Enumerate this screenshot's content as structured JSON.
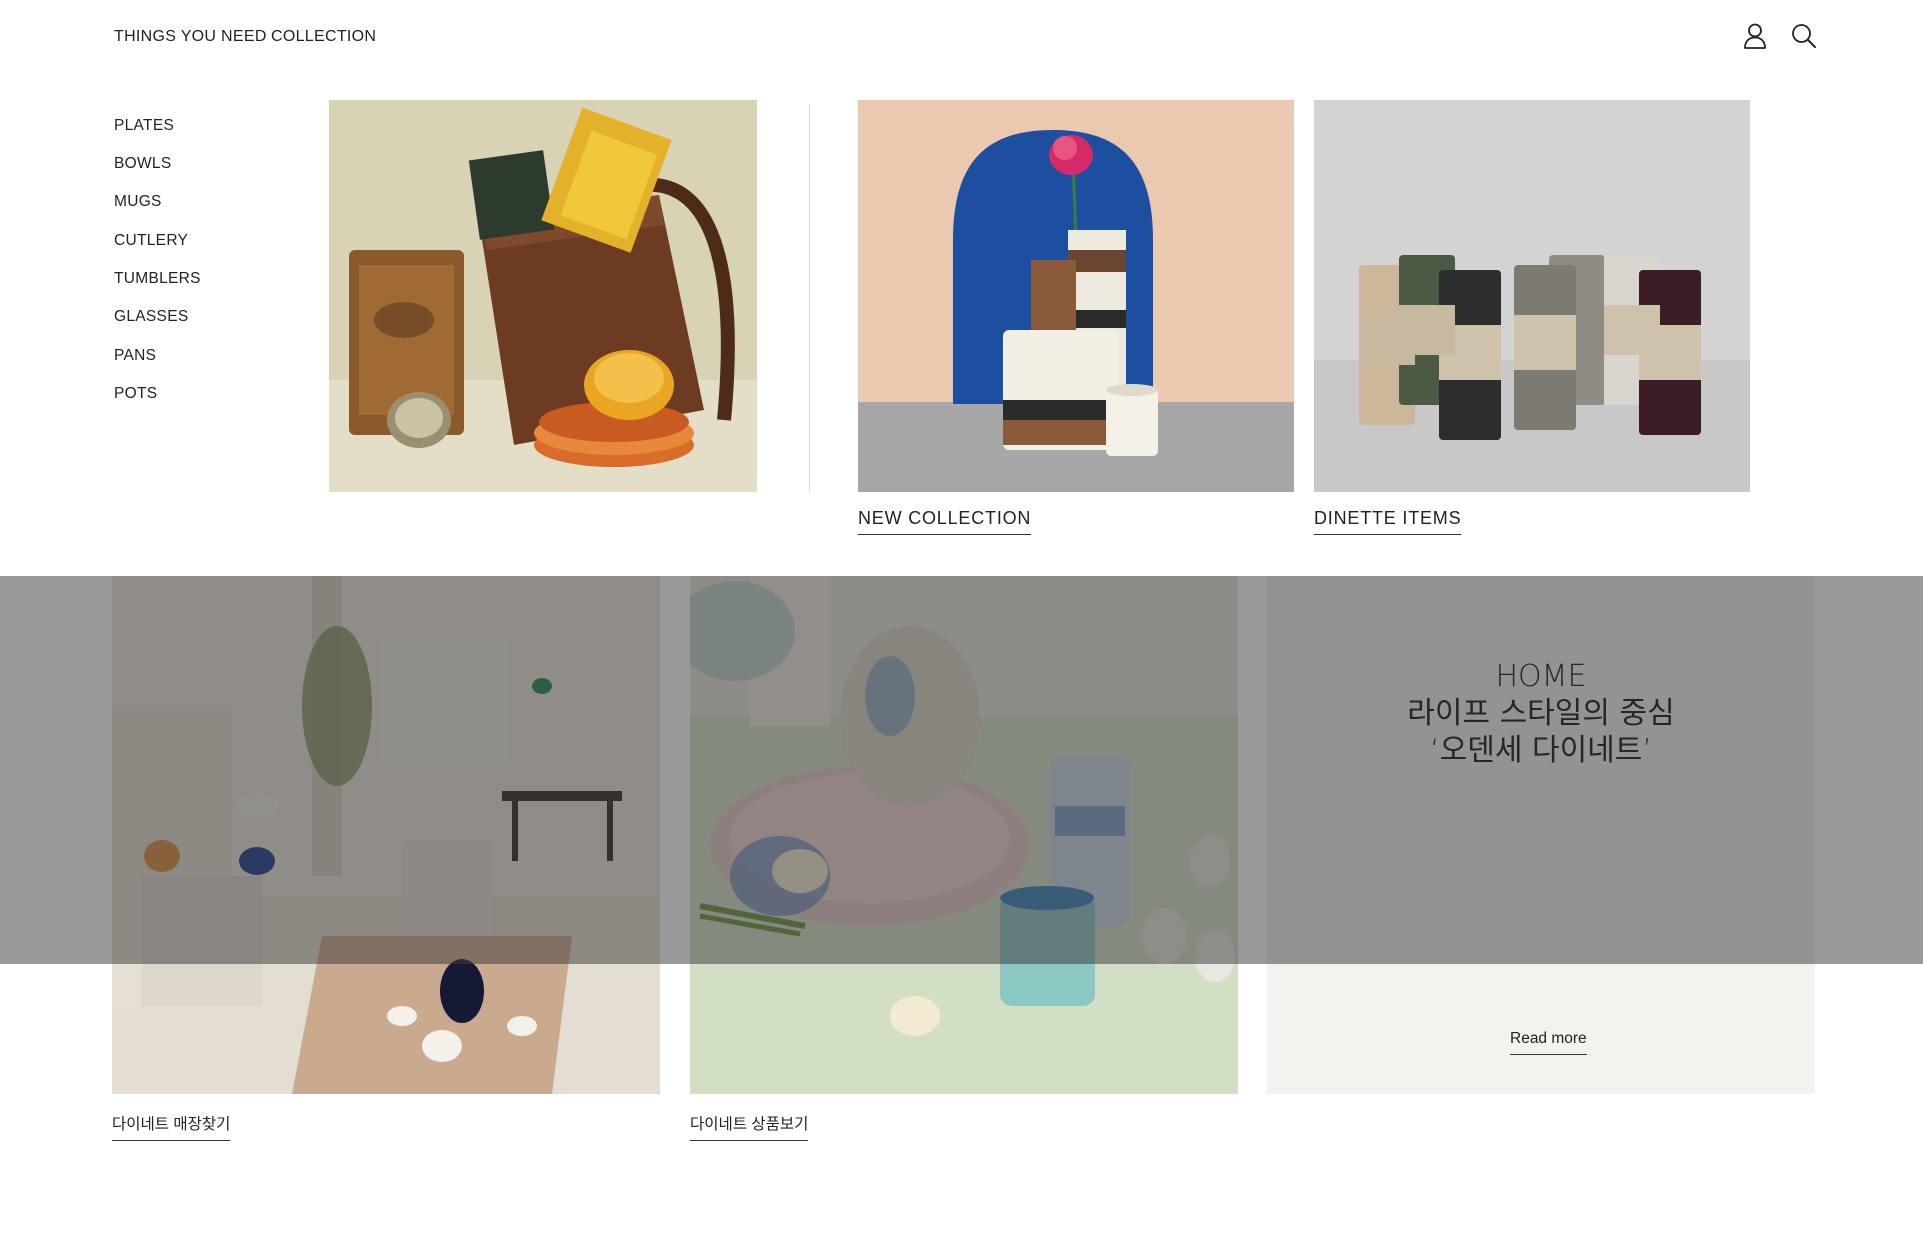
{
  "header": {
    "nav": [
      {
        "label": "THINGS YOU NEED"
      },
      {
        "label": "COLLECTION"
      }
    ],
    "icons": [
      "user-icon",
      "search-icon"
    ]
  },
  "menu": {
    "categories": [
      {
        "label": "PLATES"
      },
      {
        "label": "BOWLS"
      },
      {
        "label": "MUGS"
      },
      {
        "label": "CUTLERY"
      },
      {
        "label": "TUMBLERS"
      },
      {
        "label": "GLASSES"
      },
      {
        "label": "PANS"
      },
      {
        "label": "POTS"
      }
    ],
    "features": [
      {
        "label": "NEW  COLLECTION"
      },
      {
        "label": "DINETTE  ITEMS"
      }
    ]
  },
  "content": {
    "cards": [
      {
        "label": "다이네트 매장찾기"
      },
      {
        "label": "다이네트 상품보기"
      }
    ],
    "home": {
      "line1": "HOME",
      "line2": "라이프 스타일의 중심",
      "line3": "‘오덴세 다이네트’",
      "read_more": "Read more"
    }
  },
  "colors": {
    "overlay": "#3c3c3c",
    "home_panel": "#f4f2ef",
    "arch_blue": "#1d4fa0",
    "peach_bg": "#ebc8b0"
  }
}
